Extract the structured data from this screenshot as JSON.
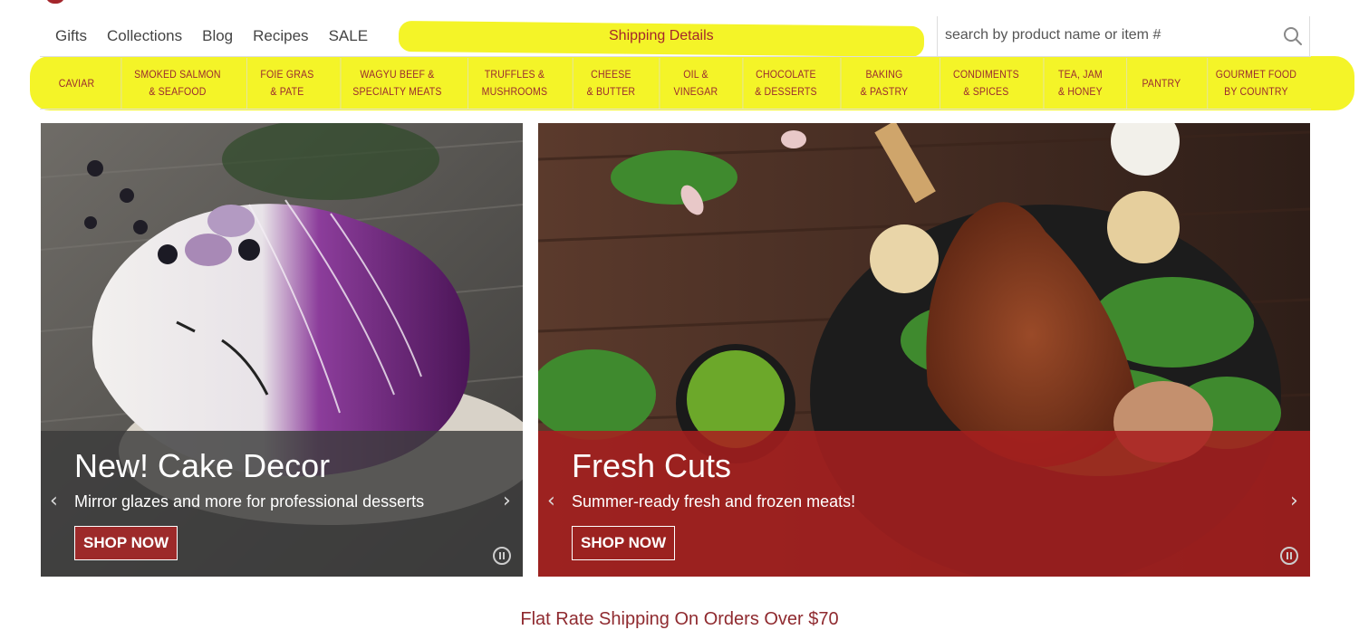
{
  "top_nav": {
    "links": [
      "Gifts",
      "Collections",
      "Blog",
      "Recipes",
      "SALE"
    ],
    "shipping_link": "Shipping Details",
    "search_placeholder": "search by product name or item #",
    "search_icon": "search-icon"
  },
  "categories": [
    "CAVIAR",
    "SMOKED SALMON\n& SEAFOOD",
    "FOIE GRAS\n& PATE",
    "WAGYU BEEF &\nSPECIALTY MEATS",
    "TRUFFLES &\nMUSHROOMS",
    "CHEESE\n& BUTTER",
    "OIL &\nVINEGAR",
    "CHOCOLATE\n& DESSERTS",
    "BAKING\n& PASTRY",
    "CONDIMENTS\n& SPICES",
    "TEA, JAM\n& HONEY",
    "PANTRY",
    "GOURMET FOOD\nBY COUNTRY"
  ],
  "banners": [
    {
      "title": "New! Cake Decor",
      "subtitle": "Mirror glazes and more for professional desserts",
      "button": "SHOP NOW"
    },
    {
      "title": "Fresh Cuts",
      "subtitle": "Summer-ready fresh and frozen meats!",
      "button": "SHOP NOW"
    }
  ],
  "arrows": {
    "prev": "‹",
    "next": "›"
  },
  "promo": "Flat Rate Shipping On Orders Over $70",
  "colors": {
    "brand": "#a4262c",
    "highlight": "#f3f30a",
    "cake_caption": "#3c3c3c",
    "meat_caption": "#a81e1e"
  }
}
